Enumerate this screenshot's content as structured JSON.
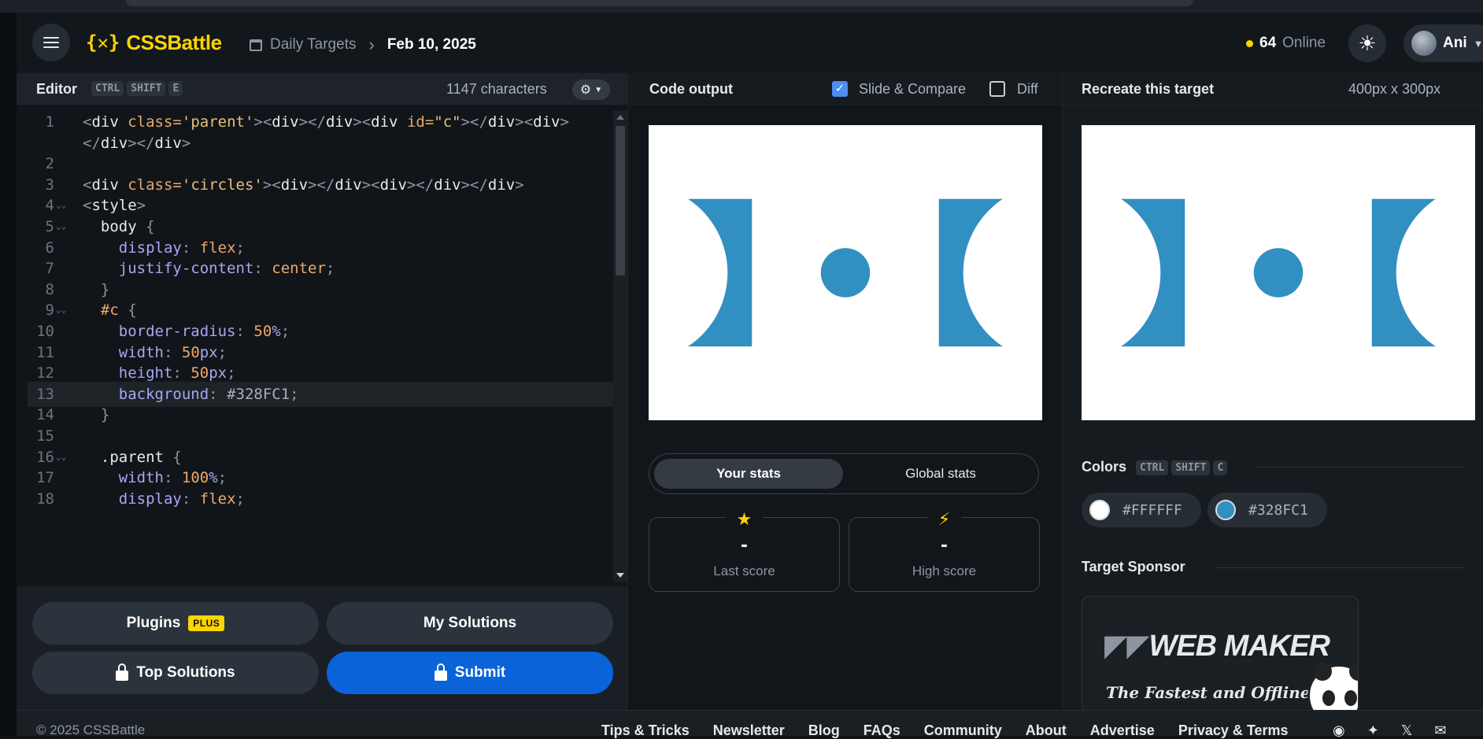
{
  "header": {
    "logo_mark": "{✕}",
    "logo_name": "CSSBattle",
    "breadcrumb_section": "Daily Targets",
    "breadcrumb_date": "Feb 10, 2025",
    "online_count": "64",
    "online_label": "Online",
    "user_name": "Ani"
  },
  "editor": {
    "title": "Editor",
    "shortcut": [
      "CTRL",
      "SHIFT",
      "E"
    ],
    "chars": "1147 characters",
    "active_line": 13,
    "lines": [
      {
        "n": "1",
        "fold": false,
        "html": "<span class='t-punc'>&lt;</span><span class='t-tag'>div</span> <span class='t-attr'>class=</span><span class='t-str'>'parent'</span><span class='t-punc'>&gt;&lt;</span><span class='t-tag'>div</span><span class='t-punc'>&gt;&lt;/</span><span class='t-tag'>div</span><span class='t-punc'>&gt;&lt;</span><span class='t-tag'>div</span> <span class='t-attr'>id=</span><span class='t-str'>\"c\"</span><span class='t-punc'>&gt;&lt;/</span><span class='t-tag'>div</span><span class='t-punc'>&gt;&lt;</span><span class='t-tag'>div</span><span class='t-punc'>&gt;</span>"
      },
      {
        "n": "",
        "fold": false,
        "html": "<span class='t-punc'>&lt;/</span><span class='t-tag'>div</span><span class='t-punc'>&gt;&lt;/</span><span class='t-tag'>div</span><span class='t-punc'>&gt;</span>"
      },
      {
        "n": "2",
        "fold": false,
        "html": ""
      },
      {
        "n": "3",
        "fold": false,
        "html": "<span class='t-punc'>&lt;</span><span class='t-tag'>div</span> <span class='t-attr'>class=</span><span class='t-str'>'circles'</span><span class='t-punc'>&gt;&lt;</span><span class='t-tag'>div</span><span class='t-punc'>&gt;&lt;/</span><span class='t-tag'>div</span><span class='t-punc'>&gt;&lt;</span><span class='t-tag'>div</span><span class='t-punc'>&gt;&lt;/</span><span class='t-tag'>div</span><span class='t-punc'>&gt;&lt;/</span><span class='t-tag'>div</span><span class='t-punc'>&gt;</span>"
      },
      {
        "n": "4",
        "fold": true,
        "html": "<span class='t-punc'>&lt;</span><span class='t-tag'>style</span><span class='t-punc'>&gt;</span>"
      },
      {
        "n": "5",
        "fold": true,
        "html": "  <span class='t-sel'>body</span> <span class='t-punc'>{</span>"
      },
      {
        "n": "6",
        "fold": false,
        "html": "    <span class='t-prop'>display</span><span class='t-punc'>:</span> <span class='t-val'>flex</span><span class='t-punc'>;</span>"
      },
      {
        "n": "7",
        "fold": false,
        "html": "    <span class='t-prop'>justify-content</span><span class='t-punc'>:</span> <span class='t-val'>center</span><span class='t-punc'>;</span>"
      },
      {
        "n": "8",
        "fold": false,
        "html": "  <span class='t-punc'>}</span>"
      },
      {
        "n": "9",
        "fold": true,
        "html": "  <span class='t-val'>#c</span> <span class='t-punc'>{</span>"
      },
      {
        "n": "10",
        "fold": false,
        "html": "    <span class='t-prop'>border-radius</span><span class='t-punc'>:</span> <span class='t-val'>50</span><span class='t-prop'>%</span><span class='t-punc'>;</span>"
      },
      {
        "n": "11",
        "fold": false,
        "html": "    <span class='t-prop'>width</span><span class='t-punc'>:</span> <span class='t-val'>50</span><span class='t-prop'>px</span><span class='t-punc'>;</span>"
      },
      {
        "n": "12",
        "fold": false,
        "html": "    <span class='t-prop'>height</span><span class='t-punc'>:</span> <span class='t-val'>50</span><span class='t-prop'>px</span><span class='t-punc'>;</span>"
      },
      {
        "n": "13",
        "fold": false,
        "html": "    <span class='t-prop'>background</span><span class='t-punc'>:</span> <span class='t-hex'>#328FC1</span><span class='t-punc'>;</span>"
      },
      {
        "n": "14",
        "fold": false,
        "html": "  <span class='t-punc'>}</span>"
      },
      {
        "n": "15",
        "fold": false,
        "html": ""
      },
      {
        "n": "16",
        "fold": true,
        "html": "  <span class='t-sel'>.parent</span> <span class='t-punc'>{</span>"
      },
      {
        "n": "17",
        "fold": false,
        "html": "    <span class='t-prop'>width</span><span class='t-punc'>:</span> <span class='t-val'>100</span><span class='t-prop'>%</span><span class='t-punc'>;</span>"
      },
      {
        "n": "18",
        "fold": false,
        "html": "    <span class='t-prop'>display</span><span class='t-punc'>:</span> <span class='t-val'>flex</span><span class='t-punc'>;</span>"
      }
    ]
  },
  "buttons": {
    "plugins": "Plugins",
    "plus_badge": "PLUS",
    "my_solutions": "My Solutions",
    "top_solutions": "Top Solutions",
    "submit": "Submit"
  },
  "output": {
    "title": "Code output",
    "slide_compare_label": "Slide & Compare",
    "slide_compare_checked": true,
    "diff_label": "Diff",
    "diff_checked": false,
    "your_stats": "Your stats",
    "global_stats": "Global stats",
    "last_score_value": "-",
    "last_score_label": "Last score",
    "high_score_value": "-",
    "high_score_label": "High score"
  },
  "target": {
    "title": "Recreate this target",
    "dims": "400px x 300px",
    "colors_title": "Colors",
    "colors_shortcut": [
      "CTRL",
      "SHIFT",
      "C"
    ],
    "colors": [
      {
        "hex": "#FFFFFF",
        "label": "#FFFFFF"
      },
      {
        "hex": "#328FC1",
        "label": "#328FC1"
      }
    ],
    "sponsor_title": "Target Sponsor",
    "sponsor_name": "WEB MAKER",
    "sponsor_tagline": "The Fastest and Offline"
  },
  "theme": {
    "accent": "#ffd400",
    "shape_color": "#328FC1",
    "canvas_bg": "#FFFFFF",
    "submit_blue": "#0a63d8"
  },
  "footer": {
    "copyright": "© 2025 CSSBattle",
    "links": [
      "Tips & Tricks",
      "Newsletter",
      "Blog",
      "FAQs",
      "Community",
      "About",
      "Advertise",
      "Privacy & Terms"
    ],
    "social_icons": [
      "discord-icon",
      "bluesky-icon",
      "x-icon",
      "email-icon"
    ]
  }
}
